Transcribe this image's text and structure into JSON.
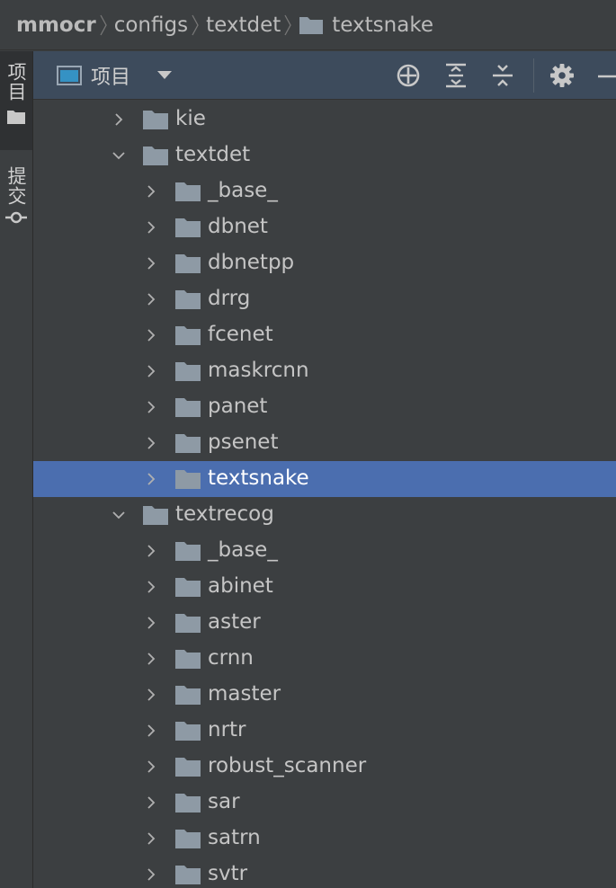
{
  "breadcrumb": {
    "items": [
      "mmocr",
      "configs",
      "textdet",
      "textsnake"
    ]
  },
  "tool_strip": {
    "tabs": [
      {
        "label": "项目",
        "icon": "folder-icon"
      },
      {
        "label": "提交",
        "icon": "commit-icon"
      }
    ]
  },
  "panel": {
    "view_label": "项目",
    "actions": [
      "locate-icon",
      "expand-all-icon",
      "collapse-all-icon",
      "gear-icon",
      "minimize-icon"
    ]
  },
  "tree": {
    "selected": "textsnake",
    "rows": [
      {
        "label": "kie",
        "depth": 1,
        "expanded": false
      },
      {
        "label": "textdet",
        "depth": 1,
        "expanded": true
      },
      {
        "label": "_base_",
        "depth": 2,
        "expanded": false
      },
      {
        "label": "dbnet",
        "depth": 2,
        "expanded": false
      },
      {
        "label": "dbnetpp",
        "depth": 2,
        "expanded": false
      },
      {
        "label": "drrg",
        "depth": 2,
        "expanded": false
      },
      {
        "label": "fcenet",
        "depth": 2,
        "expanded": false
      },
      {
        "label": "maskrcnn",
        "depth": 2,
        "expanded": false
      },
      {
        "label": "panet",
        "depth": 2,
        "expanded": false
      },
      {
        "label": "psenet",
        "depth": 2,
        "expanded": false
      },
      {
        "label": "textsnake",
        "depth": 2,
        "expanded": false
      },
      {
        "label": "textrecog",
        "depth": 1,
        "expanded": true
      },
      {
        "label": "_base_",
        "depth": 2,
        "expanded": false
      },
      {
        "label": "abinet",
        "depth": 2,
        "expanded": false
      },
      {
        "label": "aster",
        "depth": 2,
        "expanded": false
      },
      {
        "label": "crnn",
        "depth": 2,
        "expanded": false
      },
      {
        "label": "master",
        "depth": 2,
        "expanded": false
      },
      {
        "label": "nrtr",
        "depth": 2,
        "expanded": false
      },
      {
        "label": "robust_scanner",
        "depth": 2,
        "expanded": false
      },
      {
        "label": "sar",
        "depth": 2,
        "expanded": false
      },
      {
        "label": "satrn",
        "depth": 2,
        "expanded": false
      },
      {
        "label": "svtr",
        "depth": 2,
        "expanded": false
      }
    ]
  },
  "colors": {
    "selection": "#4b6eaf",
    "folder": "#8e9aa5",
    "header": "#3d4b5c"
  }
}
